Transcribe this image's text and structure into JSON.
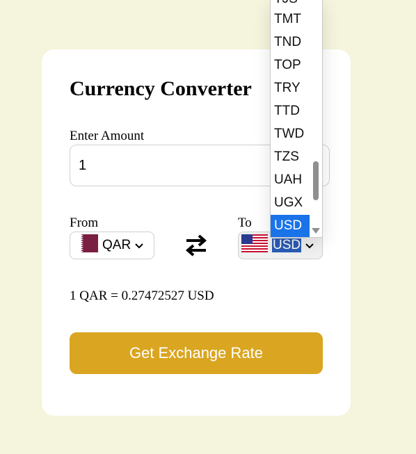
{
  "card": {
    "title": "Currency Converter",
    "amount_label": "Enter Amount",
    "amount_value": "1",
    "from_label": "From",
    "to_label": "To",
    "from_currency": "QAR",
    "to_currency": "USD",
    "rate_text": "1 QAR = 0.27472527 USD",
    "button_label": "Get Exchange Rate"
  },
  "dropdown": {
    "items": [
      "TJS",
      "TMT",
      "TND",
      "TOP",
      "TRY",
      "TTD",
      "TWD",
      "TZS",
      "UAH",
      "UGX",
      "USD"
    ],
    "selected": "USD"
  },
  "colors": {
    "page_bg": "#f5f4dc",
    "button_bg": "#daa520",
    "selected_bg": "#1a73e8",
    "qatar_maroon": "#7a1e42"
  },
  "icons": {
    "swap": "swap-arrows-icon",
    "from_flag": "qatar-flag-icon",
    "to_flag": "usa-flag-icon",
    "chevron": "chevron-down-icon"
  }
}
